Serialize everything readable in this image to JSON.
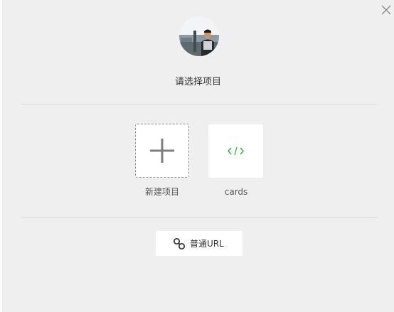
{
  "dialog": {
    "prompt": "请选择项目",
    "close_icon": "close-icon",
    "accent_color": "#3cb84a"
  },
  "projects": [
    {
      "label": "新建项目",
      "icon": "plus-icon"
    },
    {
      "label": "cards",
      "icon": "code-icon"
    }
  ],
  "url_button": {
    "label": "普通URL",
    "icon": "link-icon"
  }
}
